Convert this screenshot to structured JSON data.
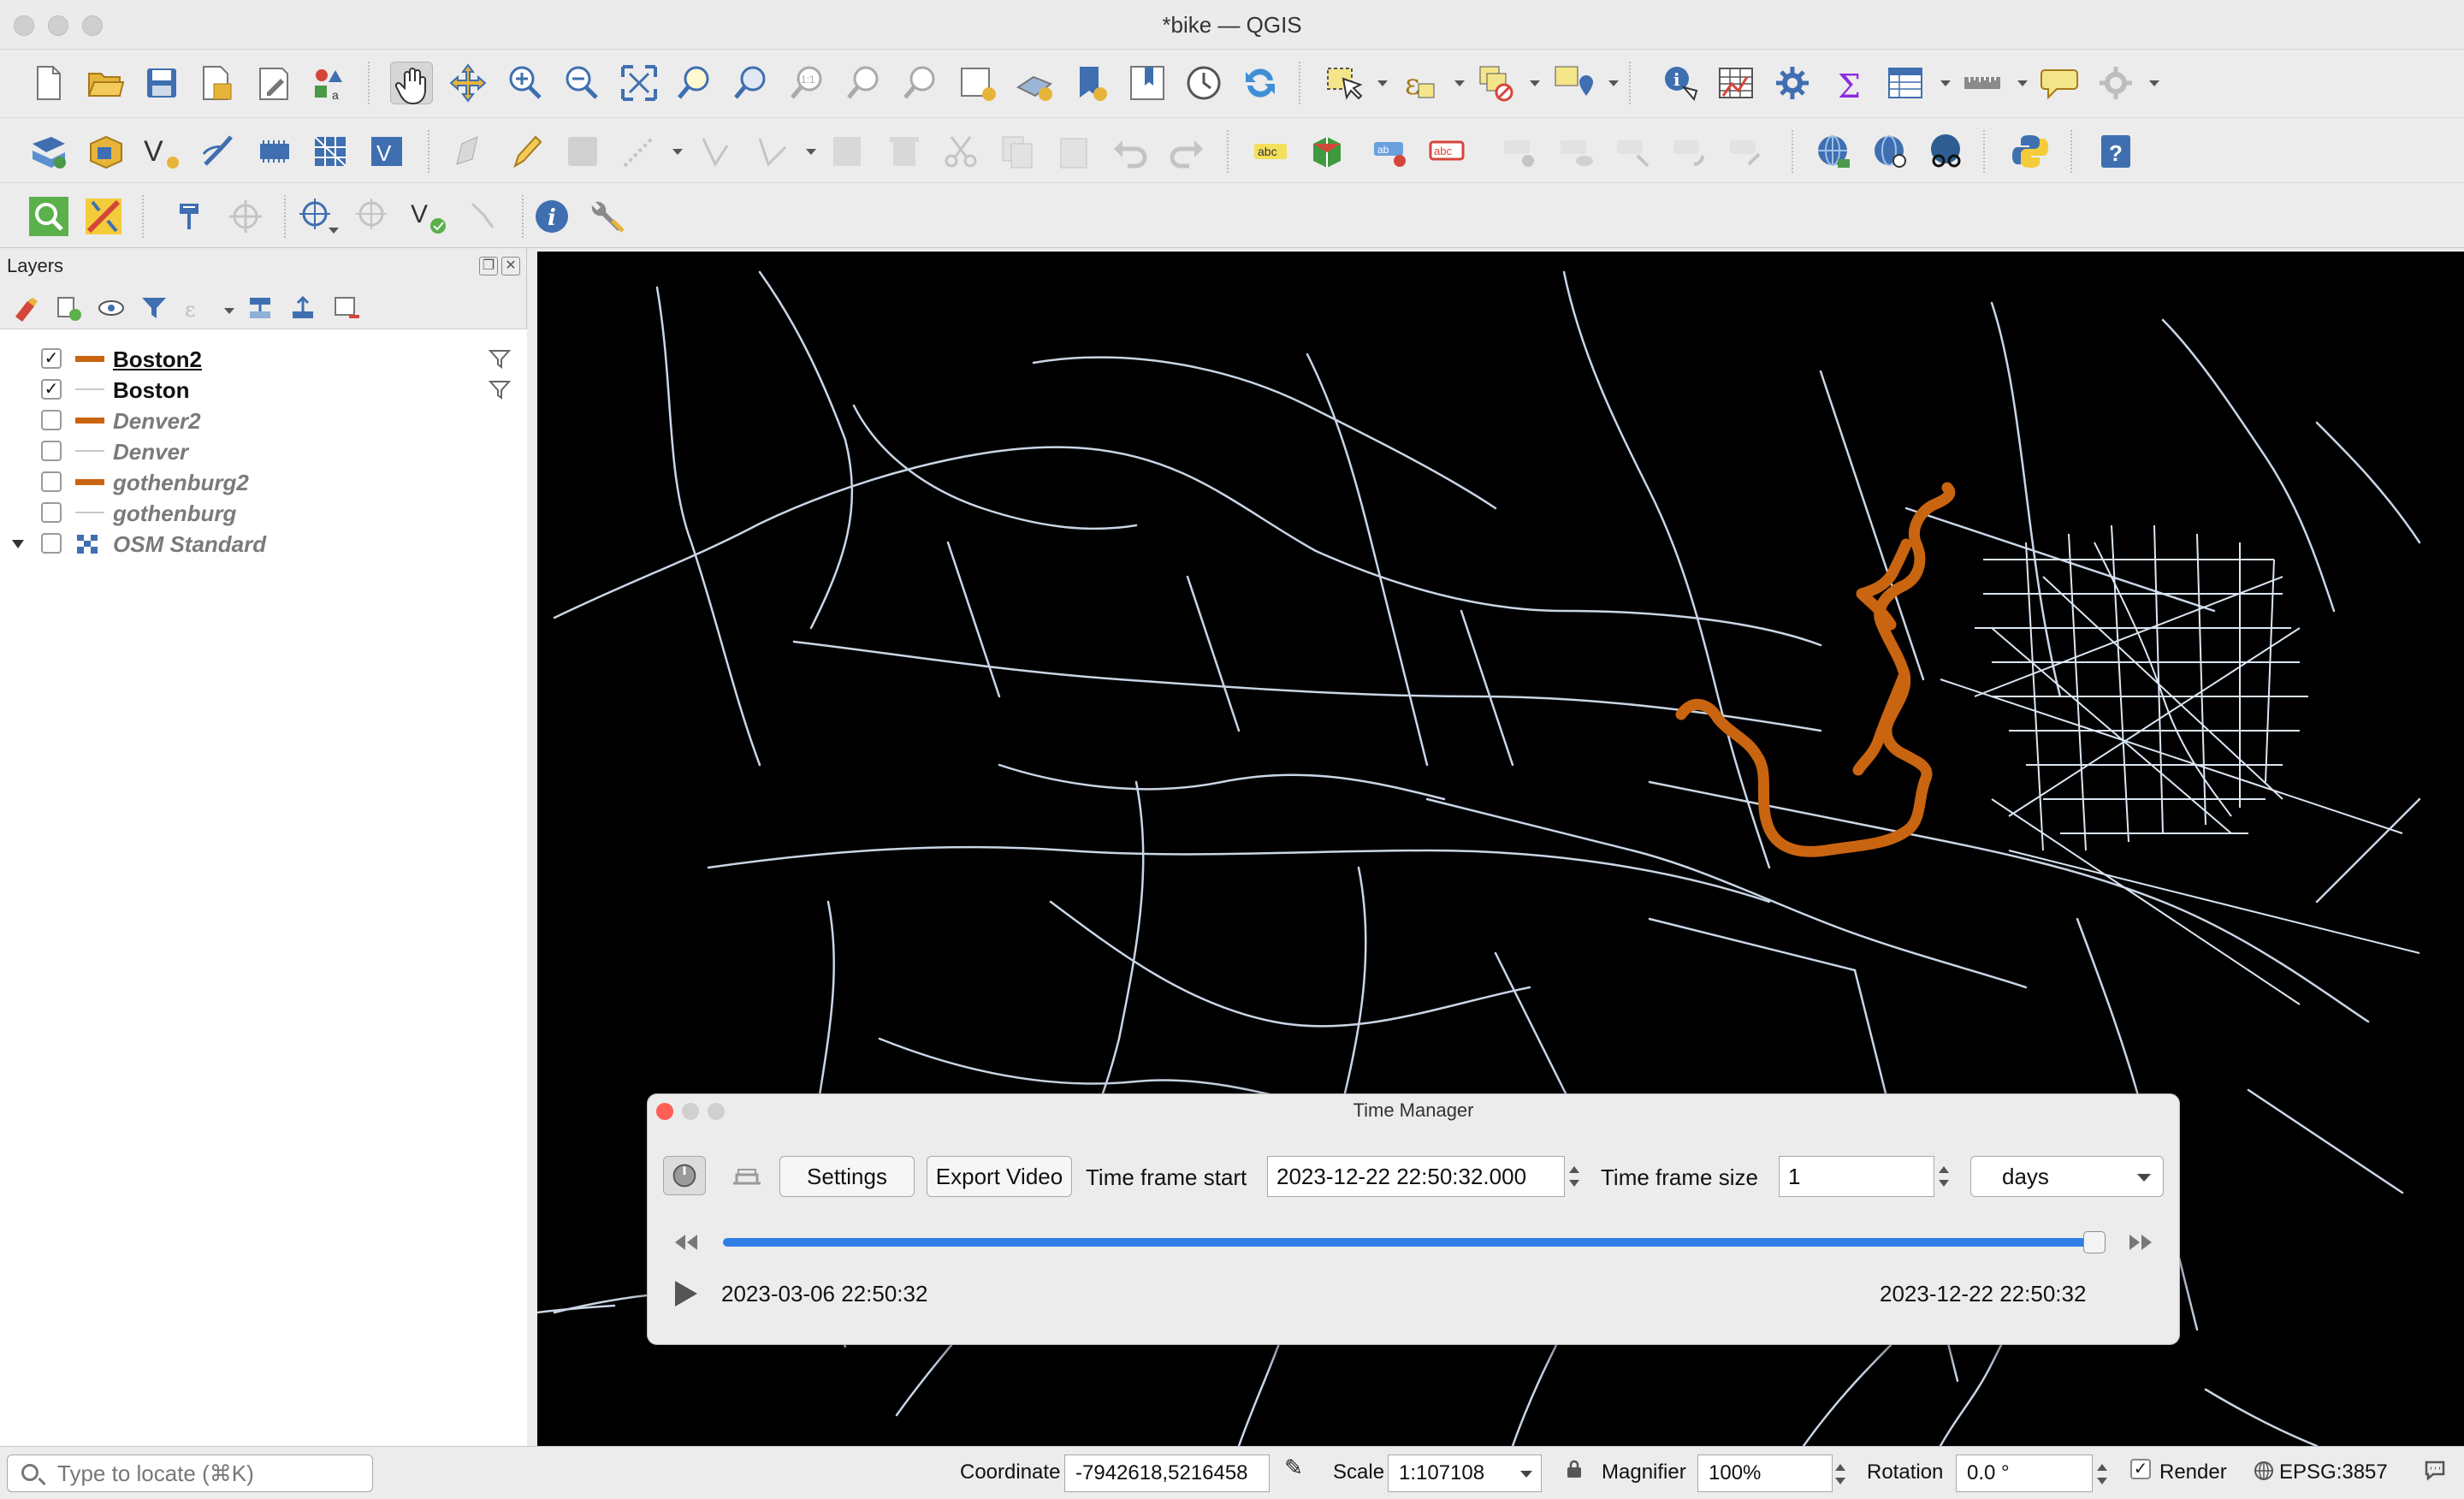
{
  "window": {
    "title": "*bike — QGIS"
  },
  "layers_panel": {
    "title": "Layers",
    "layers": [
      {
        "name": "Boston2",
        "checked": true,
        "symbol": "thick-orange-line",
        "has_filter": true
      },
      {
        "name": "Boston",
        "checked": true,
        "symbol": "thin-gray-line",
        "has_filter": true
      },
      {
        "name": "Denver2",
        "checked": false,
        "symbol": "thick-orange-line",
        "has_filter": false
      },
      {
        "name": "Denver",
        "checked": false,
        "symbol": "thin-gray-line",
        "has_filter": false
      },
      {
        "name": "gothenburg2",
        "checked": false,
        "symbol": "thick-orange-line",
        "has_filter": false
      },
      {
        "name": "gothenburg",
        "checked": false,
        "symbol": "thin-gray-line",
        "has_filter": false
      },
      {
        "name": "OSM Standard",
        "checked": false,
        "symbol": "raster-tiles",
        "has_filter": false
      }
    ]
  },
  "time_manager": {
    "title": "Time Manager",
    "settings_label": "Settings",
    "export_label": "Export Video",
    "frame_start_label": "Time frame start",
    "frame_start_value": "2023-12-22 22:50:32.000",
    "frame_size_label": "Time frame size",
    "frame_size_value": "1",
    "frame_unit": "days",
    "range_start": "2023-03-06 22:50:32",
    "range_end": "2023-12-22 22:50:32",
    "slider_fraction": 1.0
  },
  "statusbar": {
    "locator_placeholder": "Type to locate (⌘K)",
    "coordinate_label": "Coordinate",
    "coordinate_value": "-7942618,5216458",
    "scale_label": "Scale",
    "scale_value": "1:107108",
    "magnifier_label": "Magnifier",
    "magnifier_value": "100%",
    "rotation_label": "Rotation",
    "rotation_value": "0.0 °",
    "render_label": "Render",
    "render_checked": true,
    "crs_label": "EPSG:3857"
  },
  "colors": {
    "track": "#c96510",
    "roads": "#c9d6e6",
    "map_background": "#000000",
    "slider": "#2f7ee6"
  }
}
